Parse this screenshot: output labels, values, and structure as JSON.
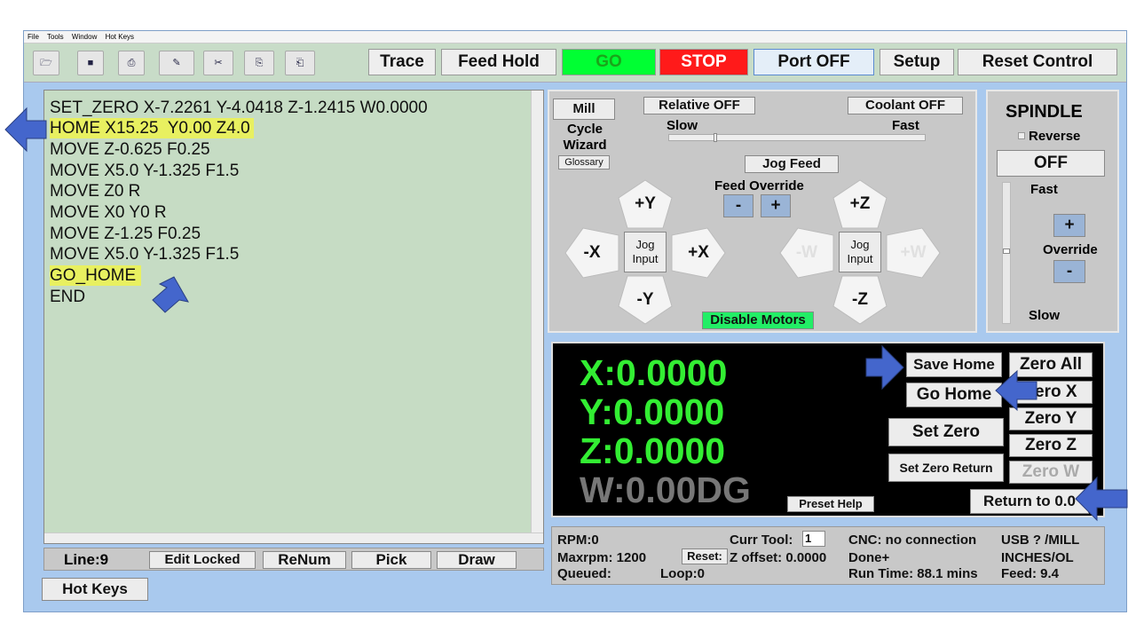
{
  "menu": [
    "File",
    "Tools",
    "Window",
    "Hot Keys"
  ],
  "toolbar": {
    "icons": [
      "open-icon",
      "save-icon",
      "print-icon",
      "eraser-icon",
      "cut-icon",
      "copy-icon",
      "paste-icon"
    ],
    "glyphs": [
      "🗁",
      "■",
      "⎙",
      "✎",
      "✂",
      "⎘",
      "⎗"
    ],
    "trace": "Trace",
    "feed_hold": "Feed Hold",
    "go": "GO",
    "stop": "STOP",
    "port": "Port OFF",
    "setup": "Setup",
    "reset": "Reset Control"
  },
  "editor": {
    "lines": [
      "SET_ZERO X-7.2261 Y-4.0418 Z-1.2415 W0.0000",
      "HOME X15.25  Y0.00 Z4.0",
      "MOVE Z-0.625 F0.25",
      "MOVE X5.0 Y-1.325 F1.5",
      "MOVE Z0 R",
      "MOVE X0 Y0 R",
      "MOVE Z-1.25 F0.25",
      "MOVE X5.0 Y-1.325 F1.5",
      "GO_HOME",
      "END"
    ],
    "line_label": "Line:9",
    "edit_locked": "Edit Locked",
    "renum": "ReNum",
    "pick": "Pick",
    "draw": "Draw"
  },
  "hot_keys": "Hot Keys",
  "jog": {
    "mill": "Mill",
    "cycle_wizard": "Cycle\nWizard",
    "glossary": "Glossary",
    "relative": "Relative OFF",
    "coolant": "Coolant OFF",
    "slow": "Slow",
    "fast": "Fast",
    "jog_feed": "Jog Feed",
    "feed_override": "Feed Override",
    "minus": "-",
    "plus": "+",
    "py": "+Y",
    "ny": "-Y",
    "nx": "-X",
    "px": "+X",
    "pz": "+Z",
    "nz": "-Z",
    "nw": "-W",
    "pw": "+W",
    "jog_input": "Jog\nInput",
    "disable_motors": "Disable Motors"
  },
  "spindle": {
    "title": "SPINDLE",
    "reverse": "Reverse",
    "off": "OFF",
    "fast": "Fast",
    "plus": "+",
    "override": "Override",
    "minus": "-",
    "slow": "Slow"
  },
  "dro": {
    "x": "X:0.0000",
    "y": "Y:0.0000",
    "z": "Z:0.0000",
    "w": "W:0.00DG",
    "save_home": "Save Home",
    "go_home": "Go Home",
    "set_zero": "Set Zero",
    "set_zero_return": "Set Zero Return",
    "preset_help": "Preset Help",
    "zero_all": "Zero All",
    "zero_x": "Zero X",
    "zero_y": "Zero Y",
    "zero_z": "Zero Z",
    "zero_w": "Zero W",
    "return": "Return to 0.0"
  },
  "status": {
    "rpm": "RPM:0",
    "maxrpm": "Maxrpm: 1200",
    "queued": "Queued:",
    "loop": "Loop:0",
    "reset": "Reset:",
    "curr_tool": "Curr Tool:",
    "tool_value": "1",
    "z_offset": "Z offset: 0.0000",
    "cnc": "CNC: no connection",
    "done": "Done+",
    "run_time": "Run Time: 88.1 mins",
    "usb": "USB ? /MILL",
    "units": "INCHES/OL",
    "feed": "Feed: 9.4"
  },
  "colors": {
    "go_bg": "#00ff33",
    "go_text": "#1aa51a",
    "stop_bg": "#ff1a1a",
    "arrow": "#4466cc",
    "dro_text": "#33ee33",
    "highlight": "#e8f060"
  }
}
